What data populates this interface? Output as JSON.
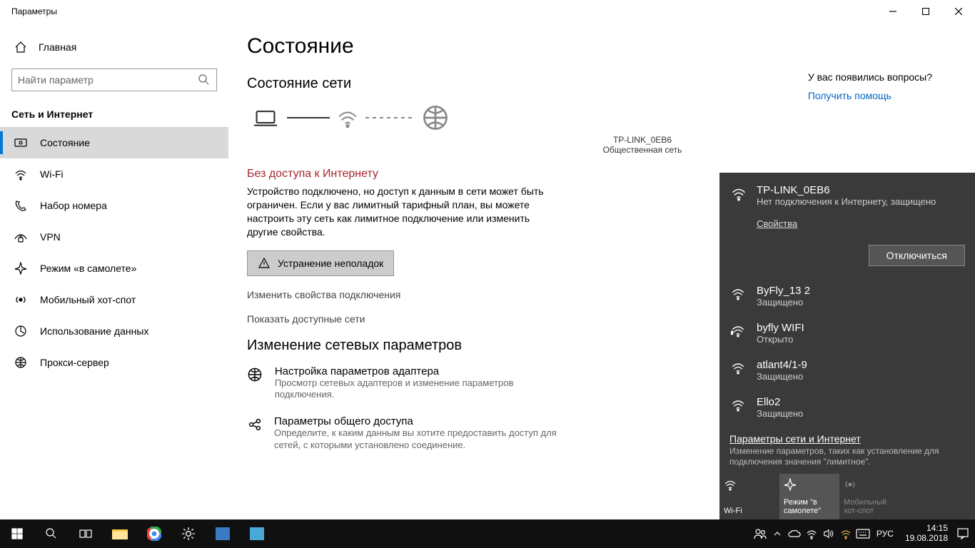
{
  "window": {
    "title": "Параметры"
  },
  "sidebar": {
    "home": "Главная",
    "search_placeholder": "Найти параметр",
    "category": "Сеть и Интернет",
    "items": [
      {
        "label": "Состояние",
        "icon": "status-icon",
        "active": true
      },
      {
        "label": "Wi-Fi",
        "icon": "wifi-icon"
      },
      {
        "label": "Набор номера",
        "icon": "dialup-icon"
      },
      {
        "label": "VPN",
        "icon": "vpn-icon"
      },
      {
        "label": "Режим «в самолете»",
        "icon": "airplane-icon"
      },
      {
        "label": "Мобильный хот-спот",
        "icon": "hotspot-icon"
      },
      {
        "label": "Использование данных",
        "icon": "data-usage-icon"
      },
      {
        "label": "Прокси-сервер",
        "icon": "proxy-icon"
      }
    ]
  },
  "main": {
    "h1": "Состояние",
    "h2": "Состояние сети",
    "diagram": {
      "ssid": "TP-LINK_0EB6",
      "net_type": "Общественная сеть"
    },
    "warning": "Без доступа к Интернету",
    "body": "Устройство подключено, но доступ к данным в сети может быть ограничен. Если у вас лимитный тарифный план, вы можете настроить эту сеть как лимитное подключение или изменить другие свойства.",
    "troubleshoot": "Устранение неполадок",
    "link1": "Изменить свойства подключения",
    "link2": "Показать доступные сети",
    "h3": "Изменение сетевых параметров",
    "adapters": [
      {
        "title": "Настройка параметров адаптера",
        "desc": "Просмотр сетевых адаптеров и изменение параметров подключения."
      },
      {
        "title": "Параметры общего доступа",
        "desc": "Определите, к каким данным вы хотите предоставить доступ для сетей, с которыми установлено соединение."
      }
    ]
  },
  "right": {
    "question": "У вас появились вопросы?",
    "help": "Получить помощь"
  },
  "flyout": {
    "connected": {
      "name": "TP-LINK_0EB6",
      "status": "Нет подключения к Интернету, защищено",
      "props": "Свойства",
      "disconnect": "Отключиться"
    },
    "networks": [
      {
        "name": "ByFly_13 2",
        "status": "Защищено",
        "secure": true
      },
      {
        "name": "byfly WIFI",
        "status": "Открыто",
        "secure": false
      },
      {
        "name": "atlant4/1-9",
        "status": "Защищено",
        "secure": true
      },
      {
        "name": "Ello2",
        "status": "Защищено",
        "secure": true
      }
    ],
    "footer": {
      "title": "Параметры сети и Интернет",
      "desc": "Изменение параметров, таких как установление для подключения значения \"лимитное\"."
    },
    "tiles": [
      {
        "label": "Wi-Fi",
        "state": "on"
      },
      {
        "label": "Режим \"в самолете\"",
        "state": "active"
      },
      {
        "label": "Мобильный хот-спот",
        "state": "disabled"
      }
    ]
  },
  "taskbar": {
    "lang": "РУС",
    "time": "14:15",
    "date": "19.08.2018"
  }
}
